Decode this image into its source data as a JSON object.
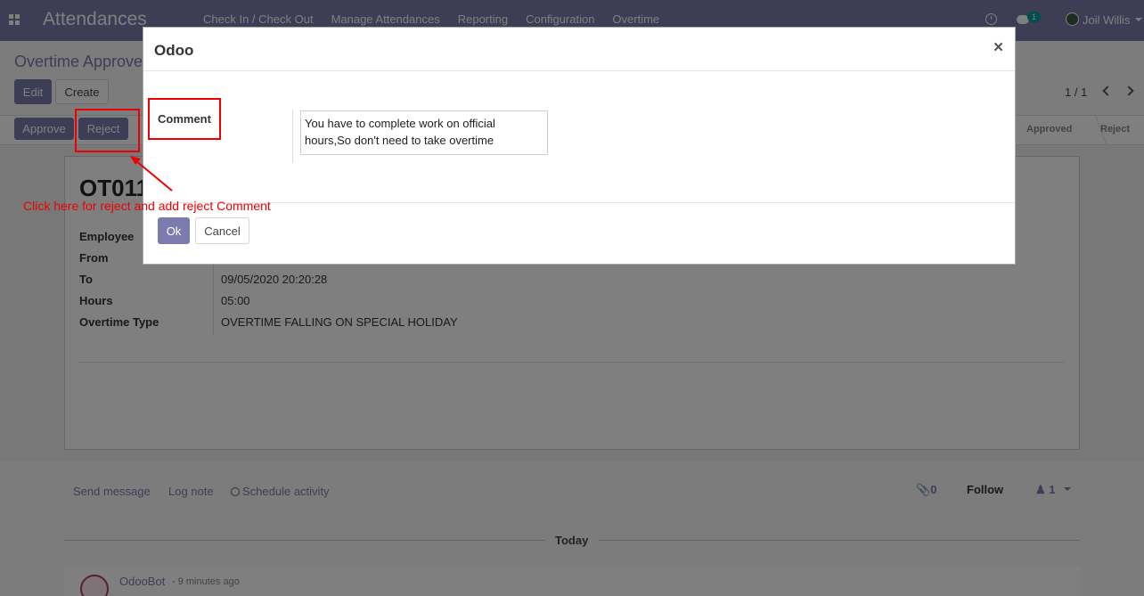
{
  "navbar": {
    "app_title": "Attendances",
    "menu": [
      "Check In / Check Out",
      "Manage Attendances",
      "Reporting",
      "Configuration",
      "Overtime"
    ],
    "chat_badge": "1",
    "user_name": "Joil Willis",
    "icons": [
      "apps-icon",
      "clock-icon",
      "chat-icon",
      "user-avatar"
    ]
  },
  "control_panel": {
    "breadcrumb": "Overtime Approve",
    "edit_label": "Edit",
    "create_label": "Create",
    "pager": "1 / 1"
  },
  "statusbar": {
    "approve_label": "Approve",
    "reject_label": "Reject",
    "stages": [
      "Approved",
      "Reject"
    ]
  },
  "form": {
    "title": "OT011",
    "fields": [
      {
        "label": "Employee",
        "value": ""
      },
      {
        "label": "From",
        "value": ""
      },
      {
        "label": "To",
        "value": "09/05/2020 20:20:28"
      },
      {
        "label": "Hours",
        "value": "05:00"
      },
      {
        "label": "Overtime Type",
        "value": "OVERTIME FALLING ON SPECIAL HOLIDAY"
      }
    ]
  },
  "chatter": {
    "send_message": "Send message",
    "log_note": "Log note",
    "schedule_activity": "Schedule activity",
    "attachments": "0",
    "follow": "Follow",
    "followers": "1",
    "today": "Today",
    "author": "OdooBot",
    "time": "- 9 minutes ago"
  },
  "dialog": {
    "title": "Odoo",
    "close": "×",
    "comment_label": "Comment",
    "comment_value": "You have to complete work on official hours,So don't need to take overtime",
    "ok_label": "Ok",
    "cancel_label": "Cancel"
  },
  "annotation": {
    "text": "Click here for reject and add reject Comment",
    "color": "#ee0000"
  },
  "colors": {
    "brand": "#7c7bad",
    "badge": "#00a09d"
  }
}
